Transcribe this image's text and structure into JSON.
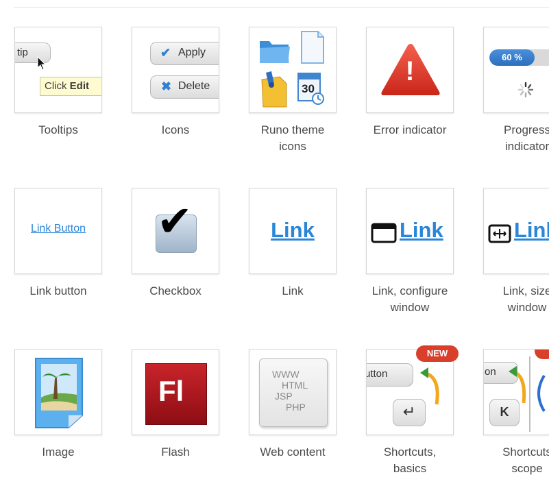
{
  "items": [
    {
      "caption": "Tooltips",
      "btn": "tip",
      "tip_plain": "Click",
      "tip_bold": "Edit"
    },
    {
      "caption": "Icons",
      "apply": "Apply",
      "delete": "Delete"
    },
    {
      "caption": "Runo theme\nicons",
      "calendar_num": "30"
    },
    {
      "caption": "Error indicator",
      "symbol": "!"
    },
    {
      "caption": "Progress\nindicator",
      "percent_label": "60 %",
      "percent": 0.6
    },
    {
      "caption": "Link button",
      "label": "Link Button"
    },
    {
      "caption": "Checkbox",
      "mark": "✔"
    },
    {
      "caption": "Link",
      "label": "Link"
    },
    {
      "caption": "Link, configure\nwindow",
      "label": "Link"
    },
    {
      "caption": "Link, size\nwindow",
      "label": "Link"
    },
    {
      "caption": "Image"
    },
    {
      "caption": "Flash",
      "label": "Fl"
    },
    {
      "caption": "Web content",
      "lines": [
        "WWW",
        "HTML",
        "JSP",
        "PHP"
      ]
    },
    {
      "caption": "Shortcuts,\nbasics",
      "badge": "NEW",
      "btn": "utton",
      "key": "↵"
    },
    {
      "caption": "Shortcuts\nscope",
      "btn": "on",
      "key": "K"
    }
  ],
  "colors": {
    "link": "#2a86d8",
    "error": "#e03a2c",
    "badge": "#d9402b",
    "flash": "#b0141b",
    "progress": "#2c6fbd"
  }
}
